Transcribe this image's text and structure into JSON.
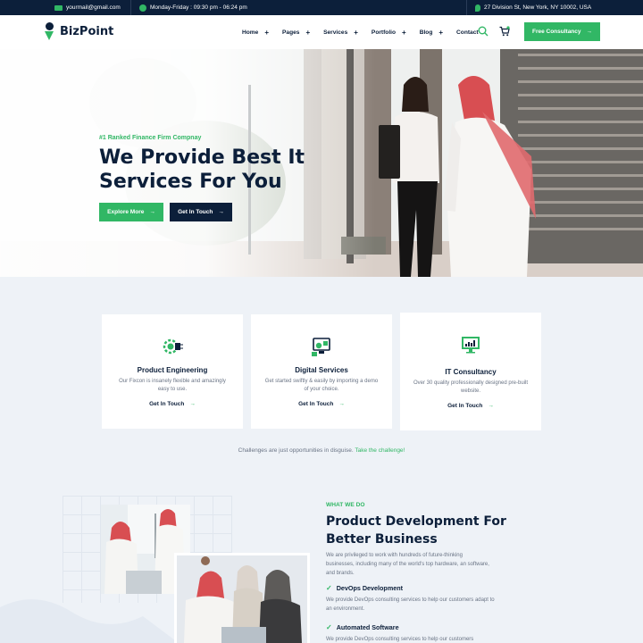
{
  "topbar": {
    "email": "yourmail@gmail.com",
    "hours": "Monday-Friday : 09:30 pm - 06:24 pm",
    "address": "27 Division St, New York, NY 10002, USA"
  },
  "header": {
    "logo": "BizPoint",
    "nav": [
      "Home",
      "Pages",
      "Services",
      "Portfolio",
      "Blog",
      "Contact"
    ],
    "nav_plus": "+",
    "cta": "Free Consultancy"
  },
  "hero": {
    "tagline": "#1 Ranked Finance Firm Compnay",
    "title": "We Provide Best It Services For You",
    "btn_primary": "Explore More",
    "btn_secondary": "Get In Touch"
  },
  "cards": [
    {
      "title": "Product Engineering",
      "desc": "Our Fixcon is insanely flexible and amazingly easy to use.",
      "link": "Get In Touch",
      "icon": "gear-chip-icon"
    },
    {
      "title": "Digital Services",
      "desc": "Get started swiftly & easily by importing a demo of your choice.",
      "link": "Get In Touch",
      "icon": "monitor-settings-icon"
    },
    {
      "title": "IT Consultancy",
      "desc": "Over 30 quality professionally designed pre-built website.",
      "link": "Get In Touch",
      "icon": "monitor-chart-icon"
    }
  ],
  "challenge": {
    "text": "Challenges are just opportunities in disguise.",
    "link": "Take the challenge!"
  },
  "what_we_do": {
    "tag": "WHAT WE DO",
    "title": "Product Development For Better Business",
    "desc": "We are privileged to work with hundreds of future-thinking businesses, including many of the world's top hardware, an software, and brands.",
    "features": [
      {
        "title": "DevOps Development",
        "desc": "We provide DevOps consulting services to help our customers adapt to an environment."
      },
      {
        "title": "Automated Software",
        "desc": "We provide DevOps consulting services to help our customers"
      }
    ]
  },
  "colors": {
    "accent": "#31b765",
    "navy": "#0c1f3a",
    "bg": "#eef2f7"
  },
  "arrow": "→",
  "check": "✓"
}
